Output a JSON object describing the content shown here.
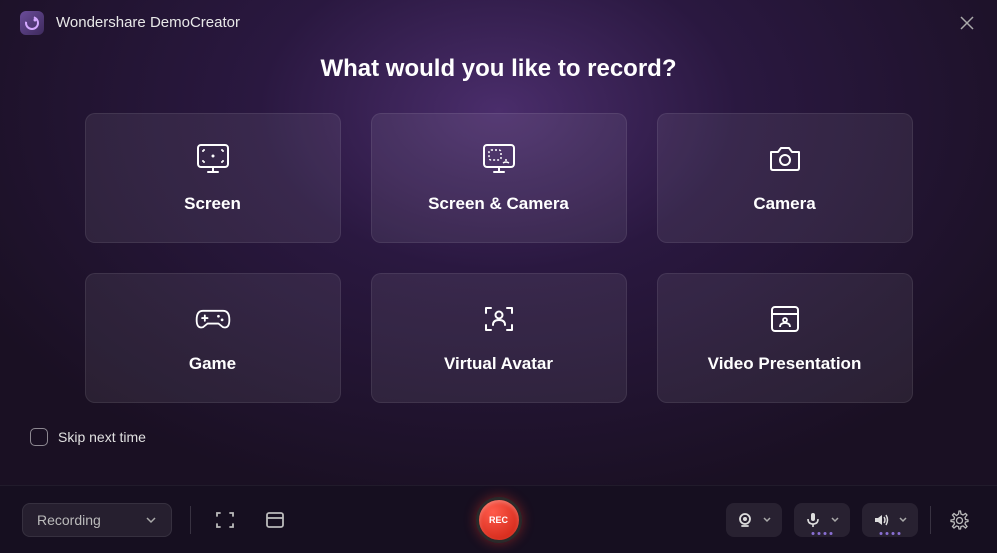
{
  "app": {
    "title": "Wondershare DemoCreator"
  },
  "heading": "What would you like to record?",
  "cards": [
    {
      "label": "Screen"
    },
    {
      "label": "Screen & Camera"
    },
    {
      "label": "Camera"
    },
    {
      "label": "Game"
    },
    {
      "label": "Virtual Avatar"
    },
    {
      "label": "Video Presentation"
    }
  ],
  "skip": {
    "label": "Skip next time",
    "checked": false
  },
  "toolbar": {
    "mode_label": "Recording",
    "rec_label": "REC"
  }
}
